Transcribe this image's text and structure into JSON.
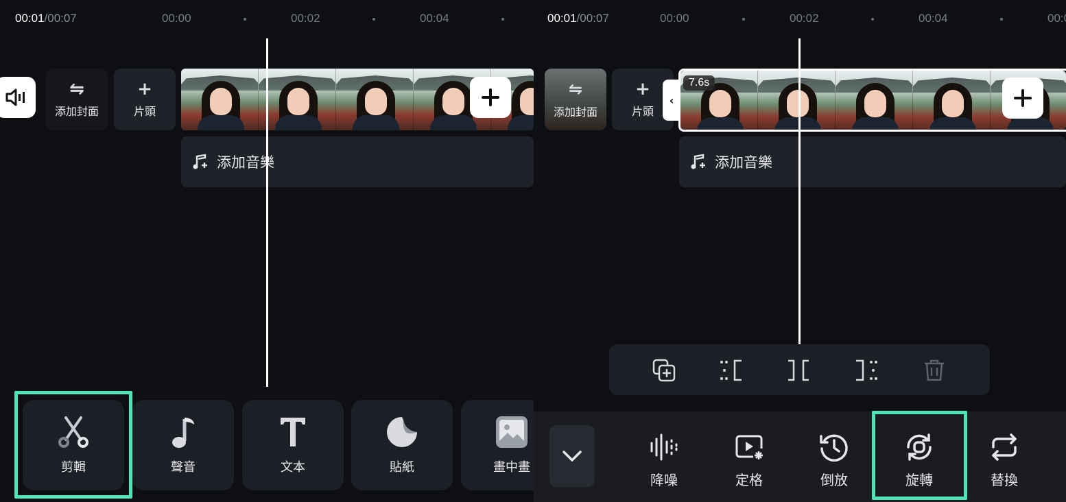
{
  "left": {
    "time_current": "00:01",
    "time_total": "/00:07",
    "ticks": [
      "00:00",
      "00:02",
      "00:04"
    ],
    "cover_label": "添加封面",
    "intro_label": "片頭",
    "music_label": "添加音樂",
    "tools": [
      {
        "label": "剪輯",
        "icon": "scissors-icon"
      },
      {
        "label": "聲音",
        "icon": "music-note-icon"
      },
      {
        "label": "文本",
        "icon": "text-icon"
      },
      {
        "label": "貼紙",
        "icon": "sticker-icon"
      },
      {
        "label": "畫中畫",
        "icon": "image-icon"
      }
    ]
  },
  "right": {
    "time_current": "00:01",
    "time_total": "/00:07",
    "ticks": [
      "00:00",
      "00:02",
      "00:04",
      "00:0"
    ],
    "cover_label": "添加封面",
    "intro_label": "片頭",
    "clip_duration": "7.6s",
    "music_label": "添加音樂",
    "edit_actions": [
      "duplicate-icon",
      "split-left-icon",
      "split-icon",
      "split-right-icon",
      "trash-icon"
    ],
    "tools": [
      {
        "label": "降噪",
        "icon": "denoise-icon"
      },
      {
        "label": "定格",
        "icon": "freeze-frame-icon"
      },
      {
        "label": "倒放",
        "icon": "reverse-icon"
      },
      {
        "label": "旋轉",
        "icon": "rotate-icon"
      },
      {
        "label": "替換",
        "icon": "replace-icon"
      }
    ]
  },
  "colors": {
    "background": "#0d0f12",
    "highlight": "#4fe3b8",
    "card": "#1f2228"
  }
}
